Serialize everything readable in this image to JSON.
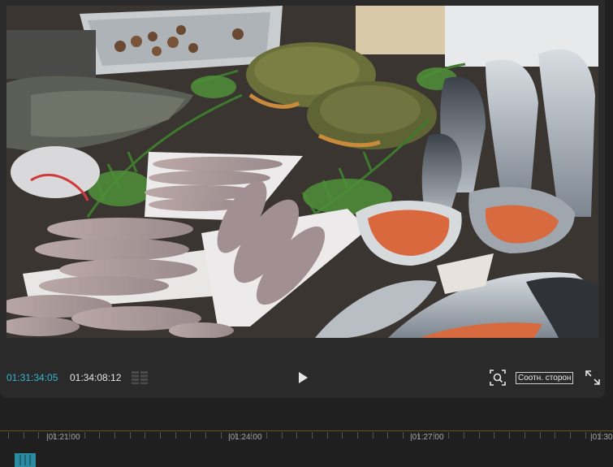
{
  "player": {
    "current_timecode": "01:31:34:05",
    "duration_timecode": "01:34:08:12",
    "aspect_label": "Соотн. сторон",
    "icons": {
      "split": "split-view-icon",
      "play": "play-icon",
      "zoom": "zoom-fit-icon",
      "fullscreen": "fullscreen-icon"
    },
    "colors": {
      "timecode_accent": "#35b6cf",
      "panel_bg": "#2a2a2a"
    }
  },
  "timeline": {
    "labels": [
      "|01:21:00",
      "|01:24:00",
      "|01:27:00",
      "|01:30"
    ],
    "clip_color": "#2c8aa0",
    "ruler_color": "#6a5424"
  }
}
